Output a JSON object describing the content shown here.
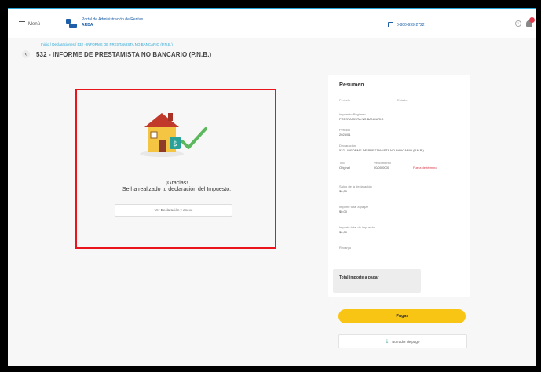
{
  "header": {
    "menu_label": "Menú",
    "brand_line1": "Portal de Administración de Rentas",
    "brand_line2": "ARBA",
    "phone": "0-800-999-2722"
  },
  "breadcrumb": "Inicio / Declaraciones / 532 - INFORME DE PRESTAMISTA NO BANCARIO (P.N.B.)",
  "page_title": "532 - INFORME DE PRESTAMISTA NO BANCARIO (P.N.B.)",
  "success": {
    "line1": "¡Gracias!",
    "line2": "Se ha realizado tu declaración del Impuesto.",
    "view_button": "Ver Declaración y anexo"
  },
  "summary": {
    "title": "Resumen",
    "meta1": "Período",
    "meta2": "Estado",
    "rows": [
      {
        "label": "Impuesto/Régimen",
        "value": "PRESTAMISTA NO BANCARIO"
      },
      {
        "label": "Período",
        "value": "2023/01"
      },
      {
        "label": "Declaración",
        "value": "532 - INFORME DE PRESTAMISTA NO BANCARIO (P.N.B.)"
      },
      {
        "label": "Presentada",
        "value": "Declaración"
      },
      {
        "label": "Saldo de la declaración",
        "value": "$0,00"
      },
      {
        "label": "Importe total a pagar",
        "value": "$0,00"
      },
      {
        "label": "Importe total de impuesto",
        "value": "$0,00"
      },
      {
        "label": "Recargo",
        "value": ""
      }
    ],
    "col_a_label": "Tipo",
    "col_a_value": "Original",
    "col_b_label": "Vencimiento",
    "col_b_value": "00/00/0000",
    "col_c_value": "Fuera de término",
    "total_label": "Total importe a pagar"
  },
  "actions": {
    "pay": "Pagar",
    "draft": "Borrador de pago"
  },
  "colors": {
    "accent": "#2aa7d6",
    "brand": "#1d5fa8",
    "pay": "#f9c515",
    "highlight": "#e8141e"
  }
}
